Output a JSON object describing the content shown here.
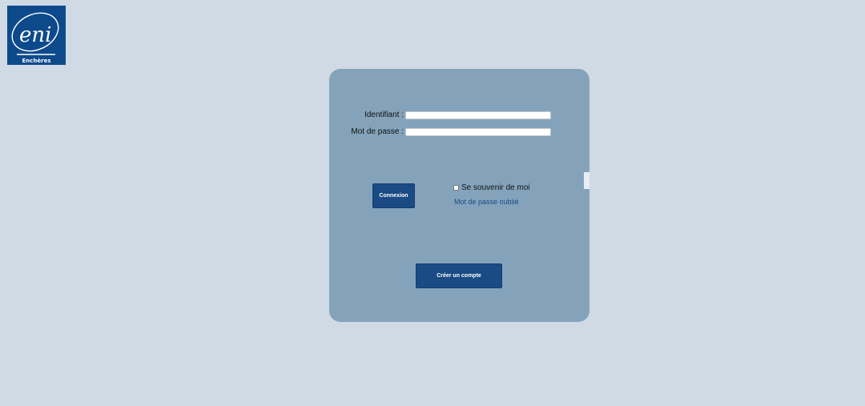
{
  "brand": {
    "logo_mark": "eni",
    "logo_caption": "Enchères",
    "color": "#0d4a8c"
  },
  "login": {
    "username_label": "Identifiant :",
    "username_value": "",
    "password_label": "Mot de passe :",
    "password_value": "",
    "connect_button": "Connexion",
    "remember_label": "Se souvenir de moi",
    "remember_checked": false,
    "forgot_link": "Mot de passe oublié",
    "create_account_button": "Créer un compte"
  },
  "colors": {
    "page_background": "#d0dae4",
    "card_background": "#84a3bb",
    "button": "#1b4b84",
    "link": "#1b4b84"
  }
}
